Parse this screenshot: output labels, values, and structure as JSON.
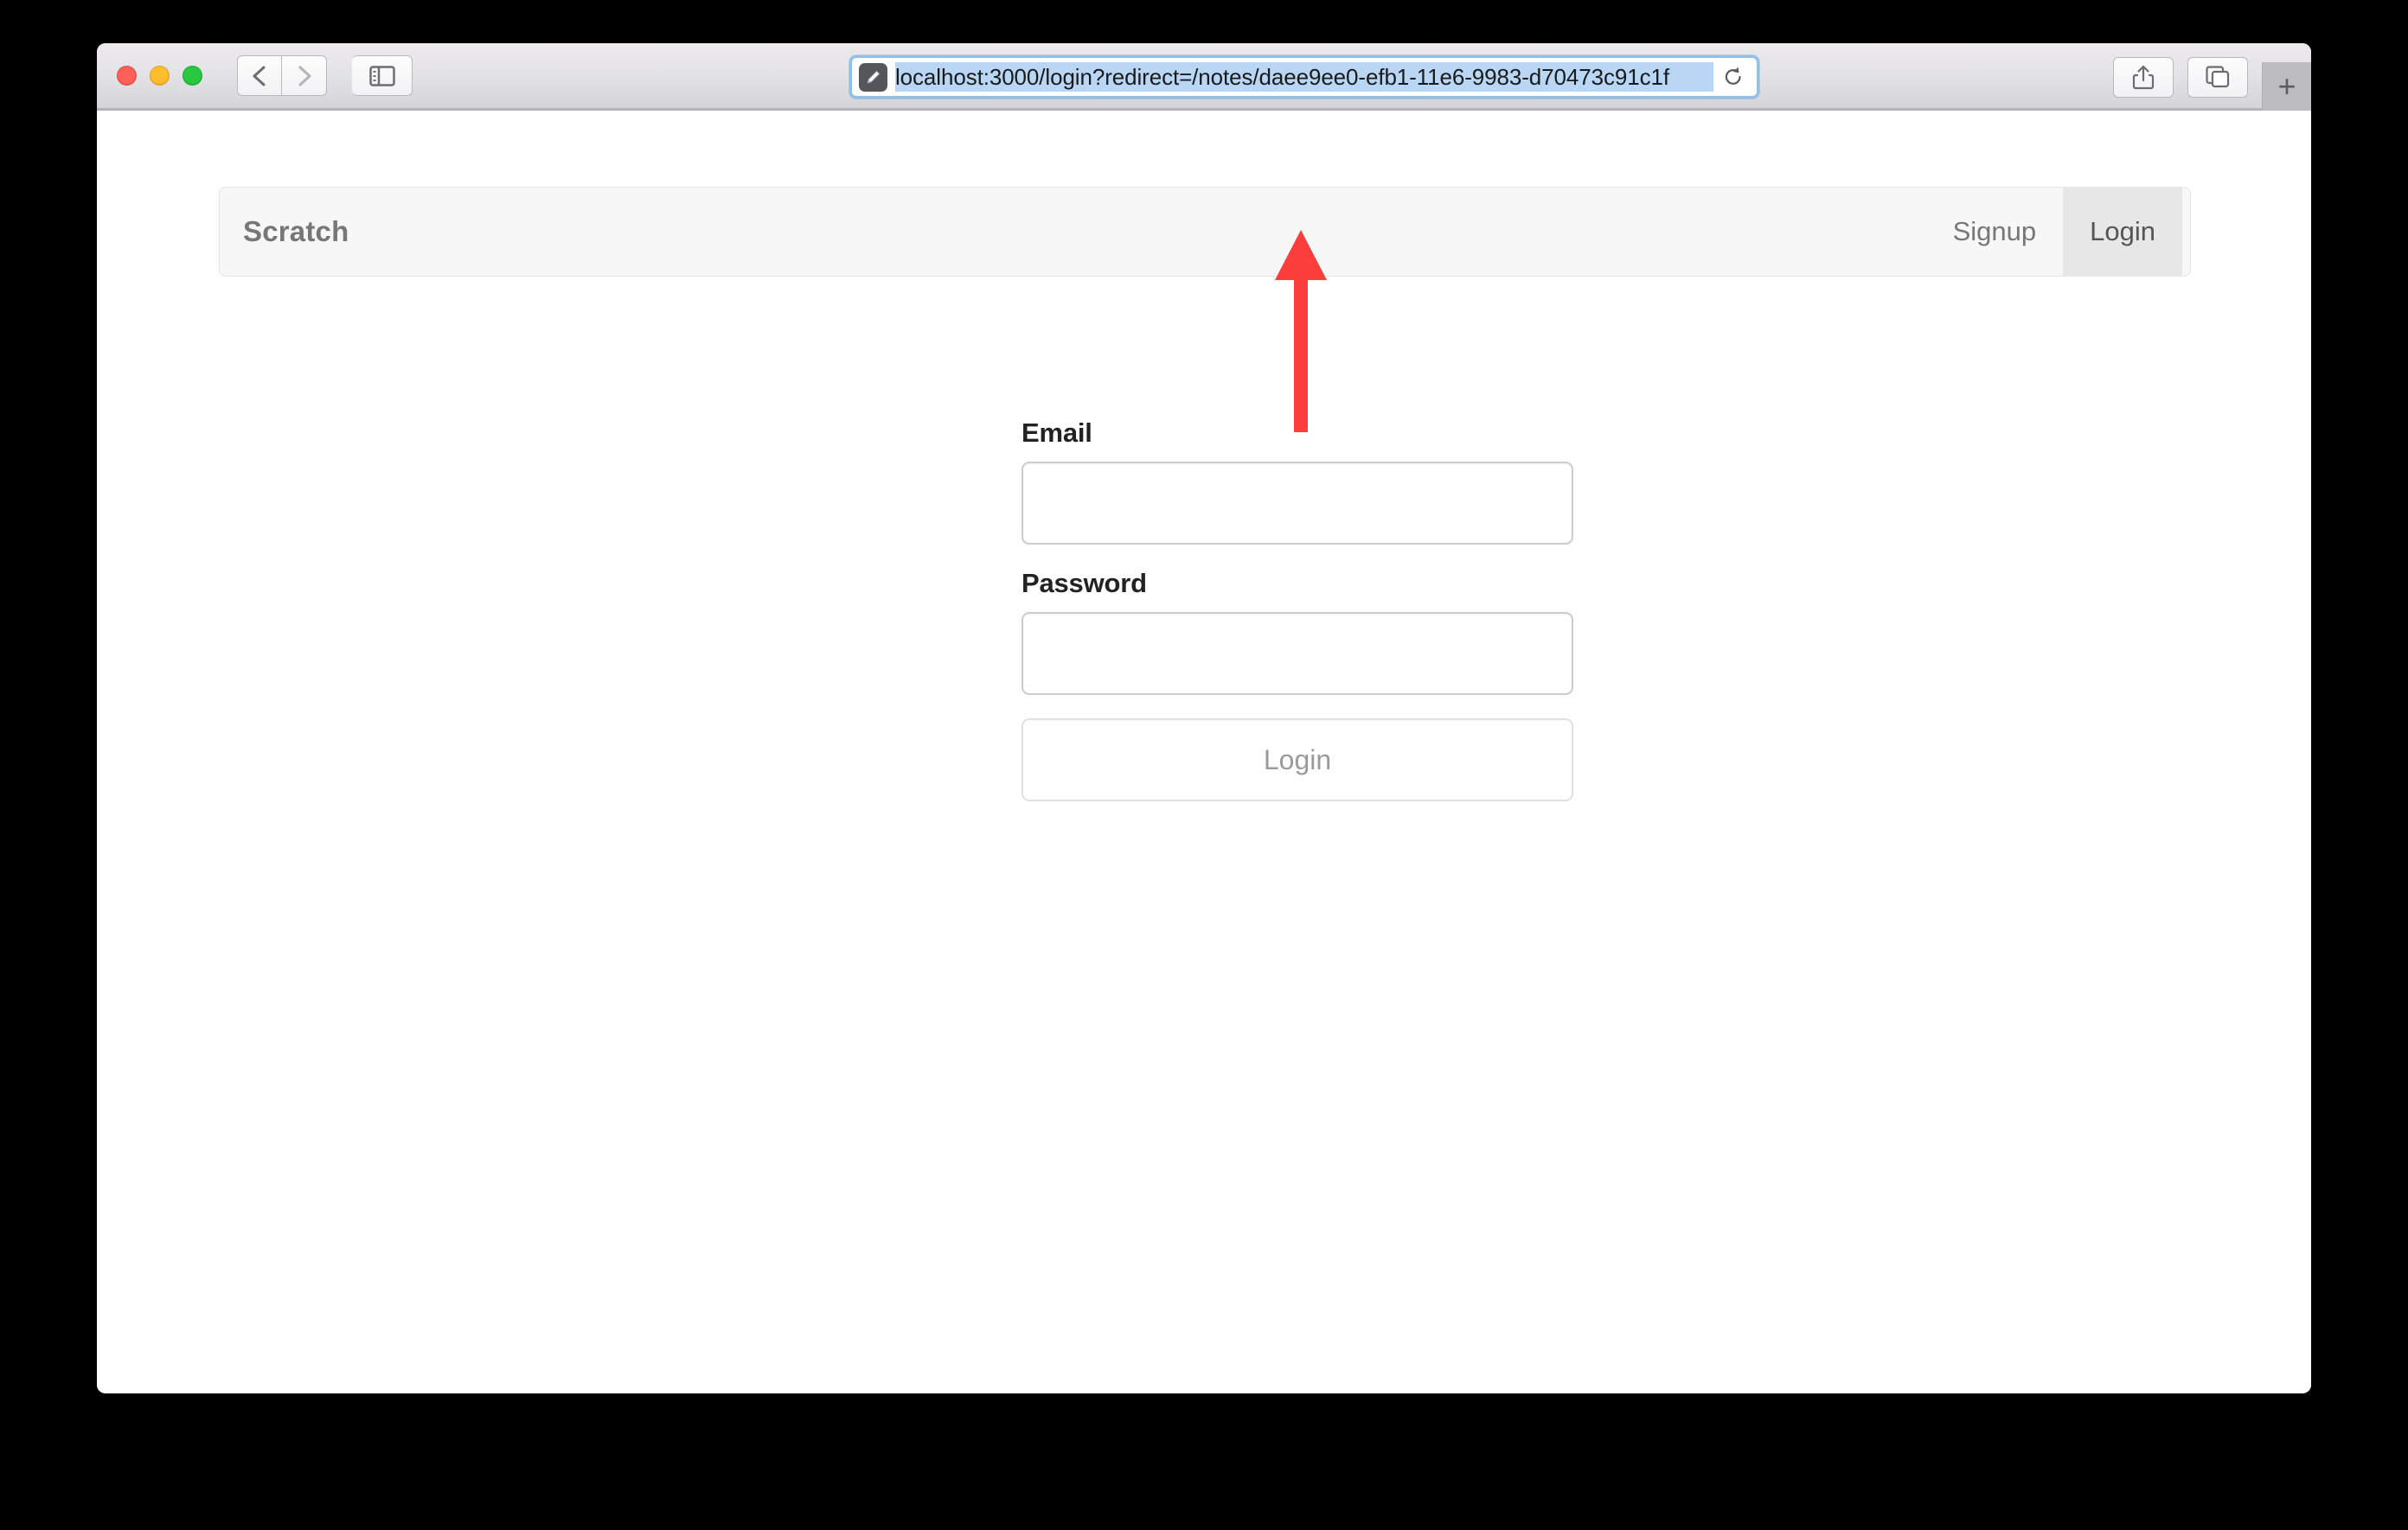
{
  "browser": {
    "name": "safari-browser-window",
    "traffic_lights": [
      {
        "name": "close-button",
        "color": "#ff6159"
      },
      {
        "name": "minimize-button",
        "color": "#ffbd2e"
      },
      {
        "name": "zoom-button",
        "color": "#28c941"
      }
    ],
    "back_label": "Back",
    "forward_label": "Forward",
    "sidebar_label": "Show Sidebar",
    "share_label": "Share",
    "tab_overview_label": "Show Tab Overview",
    "new_tab_label": "+",
    "address_bar": {
      "url": "localhost:3000/login?redirect=/notes/daee9ee0-efb1-11e6-9983-d70473c91c1f",
      "placeholder": "Search or enter website name",
      "edit_icon": "pencil-icon",
      "reload_icon": "reload-icon",
      "selected": true,
      "focus_ring_color": "#8ec0ec",
      "selection_color": "#b9d7f5"
    }
  },
  "navbar": {
    "brand": "Scratch",
    "links": [
      {
        "label": "Signup",
        "active": false
      },
      {
        "label": "Login",
        "active": true
      }
    ],
    "background": "#f7f7f7",
    "active_background": "#e7e7e7"
  },
  "login_form": {
    "email": {
      "label": "Email",
      "value": "",
      "placeholder": ""
    },
    "password": {
      "label": "Password",
      "value": "",
      "placeholder": ""
    },
    "submit_label": "Login",
    "submit_disabled": true
  },
  "annotation": {
    "arrow": {
      "direction": "up",
      "color": "#fb3d3b",
      "points_to": "address-bar"
    }
  }
}
